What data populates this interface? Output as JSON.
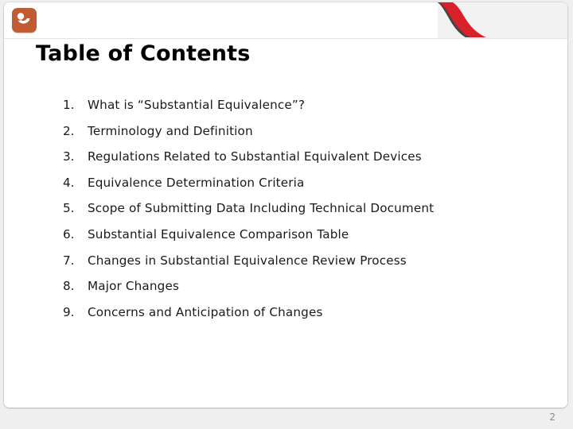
{
  "slide": {
    "title": "Table of Contents",
    "page_number": "2",
    "logo": {
      "icon_name": "smiley-face-logo-icon",
      "background_color": "#bf5c33",
      "mark_color": "#ffffff"
    },
    "swoosh": {
      "icon_name": "red-ribbon-swoosh-icon",
      "red_color": "#d82128",
      "dark_edge_color": "#4a4445"
    },
    "theme": {
      "canvas_background": "#efefef",
      "card_background": "#ffffff",
      "header_background": "#f2f2f2",
      "title_color": "#000000",
      "text_color": "#1a1a1a",
      "page_number_color": "#8a8a8a"
    },
    "contents": [
      {
        "number": "1.",
        "label": "What is “Substantial Equivalence”?"
      },
      {
        "number": "2.",
        "label": "Terminology and Definition"
      },
      {
        "number": "3.",
        "label": "Regulations Related to Substantial Equivalent Devices"
      },
      {
        "number": "4.",
        "label": "Equivalence Determination Criteria"
      },
      {
        "number": "5.",
        "label": "Scope of Submitting Data Including Technical Document"
      },
      {
        "number": "6.",
        "label": "Substantial Equivalence Comparison Table"
      },
      {
        "number": "7.",
        "label": "Changes in Substantial Equivalence Review Process"
      },
      {
        "number": "8.",
        "label": "Major Changes"
      },
      {
        "number": "9.",
        "label": "Concerns and Anticipation of Changes"
      }
    ]
  }
}
